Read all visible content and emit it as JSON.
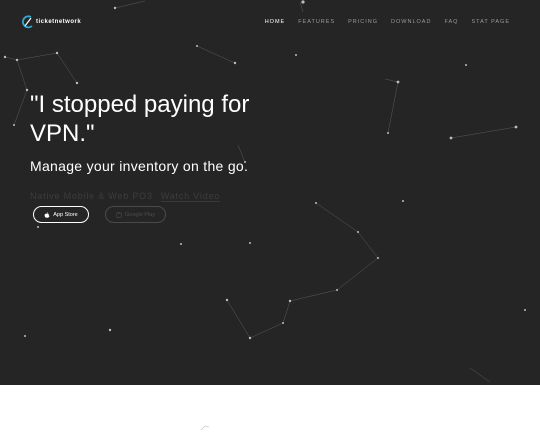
{
  "brand": {
    "name": "ticketnetwork"
  },
  "nav": {
    "items": [
      {
        "label": "HOME",
        "active": true
      },
      {
        "label": "FEATURES",
        "active": false
      },
      {
        "label": "PRICING",
        "active": false
      },
      {
        "label": "DOWNLOAD",
        "active": false
      },
      {
        "label": "FAQ",
        "active": false
      },
      {
        "label": "STAT PAGE",
        "active": false
      }
    ]
  },
  "hero": {
    "headline": "\"I stopped paying for VPN.\"",
    "subhead": "Manage your inventory on the go.",
    "platforms": "Native Mobile & Web PO3",
    "watch_video": "Watch Video",
    "appstore_label": "App Store",
    "googleplay_label": "Google Play"
  },
  "colors": {
    "hero_background": "#252525",
    "page_background": "#ffffff",
    "nav_text": "#9a9a9a",
    "brand_accent": "#2fa9d8"
  },
  "icons": [
    "ticketnetwork-logo-icon",
    "apple-icon",
    "google-play-icon"
  ]
}
